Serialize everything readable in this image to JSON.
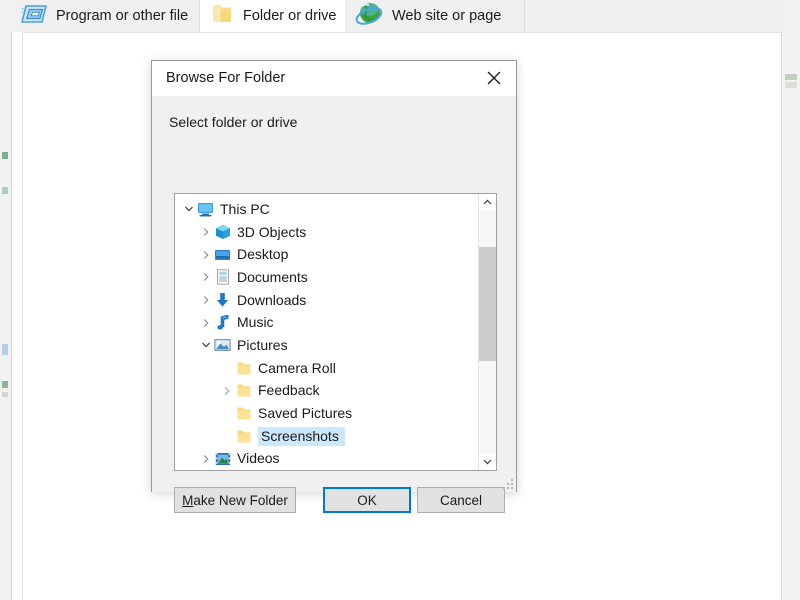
{
  "window": {
    "tabs": [
      {
        "id": "program-or-other-file",
        "label": "Program or other file",
        "icon": "program-window-icon",
        "active": false
      },
      {
        "id": "folder-or-drive",
        "label": "Folder or drive",
        "icon": "folder-icon",
        "active": true
      },
      {
        "id": "web-site-or-page",
        "label": "Web site or page",
        "icon": "globe-icon",
        "active": false
      }
    ]
  },
  "dialog": {
    "title": "Browse For Folder",
    "close_label": "Close",
    "prompt": "Select folder or drive",
    "tree": {
      "nodes": [
        {
          "label": "This PC",
          "level": 0,
          "twisty": "expanded",
          "icon": "this-pc-icon",
          "selected": false
        },
        {
          "label": "3D Objects",
          "level": 1,
          "twisty": "collapsed",
          "icon": "3d-objects-icon",
          "selected": false
        },
        {
          "label": "Desktop",
          "level": 1,
          "twisty": "collapsed",
          "icon": "desktop-icon",
          "selected": false
        },
        {
          "label": "Documents",
          "level": 1,
          "twisty": "collapsed",
          "icon": "documents-icon",
          "selected": false
        },
        {
          "label": "Downloads",
          "level": 1,
          "twisty": "collapsed",
          "icon": "downloads-icon",
          "selected": false
        },
        {
          "label": "Music",
          "level": 1,
          "twisty": "collapsed",
          "icon": "music-icon",
          "selected": false
        },
        {
          "label": "Pictures",
          "level": 1,
          "twisty": "expanded",
          "icon": "pictures-icon",
          "selected": false
        },
        {
          "label": "Camera Roll",
          "level": 2,
          "twisty": "none",
          "icon": "folder-icon",
          "selected": false
        },
        {
          "label": "Feedback",
          "level": 2,
          "twisty": "collapsed",
          "icon": "folder-icon",
          "selected": false
        },
        {
          "label": "Saved Pictures",
          "level": 2,
          "twisty": "none",
          "icon": "folder-icon",
          "selected": false
        },
        {
          "label": "Screenshots",
          "level": 2,
          "twisty": "none",
          "icon": "folder-icon",
          "selected": true
        },
        {
          "label": "Videos",
          "level": 1,
          "twisty": "collapsed",
          "icon": "videos-icon",
          "selected": false
        }
      ],
      "scrollbar": {
        "up_arrow": "scroll-up",
        "down_arrow": "scroll-down"
      }
    },
    "buttons": {
      "make_new_folder": {
        "accel": "M",
        "rest": "ake New Folder"
      },
      "ok": "OK",
      "cancel": "Cancel"
    }
  },
  "colors": {
    "selection": "#cce8ff",
    "focus_border": "#0078d7",
    "dialog_bg": "#f0f0f0",
    "button_bg": "#e1e1e1",
    "folder_yellow": "#ffd869"
  }
}
